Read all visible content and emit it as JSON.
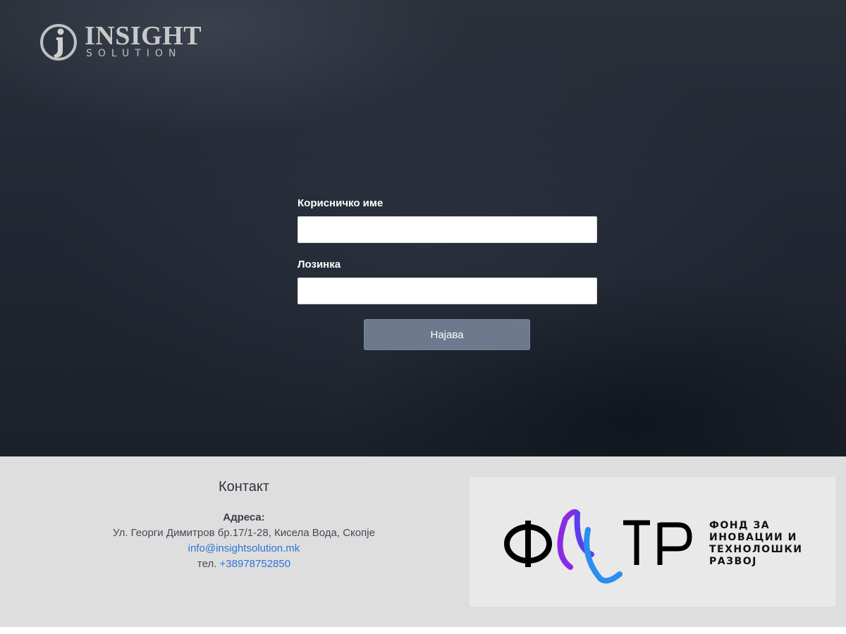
{
  "brand": {
    "name": "INSIGHT",
    "subtitle": "SOLUTION"
  },
  "login": {
    "username_label": "Корисничко име",
    "username_value": "",
    "password_label": "Лозинка",
    "password_value": "",
    "submit_label": "Најава"
  },
  "contact": {
    "title": "Контакт",
    "address_label": "Адреса:",
    "address": "Ул. Георги Димитров бр.17/1-28, Кисела Вода, Скопје",
    "email": "info@insightsolution.mk",
    "phone_prefix": "тел.",
    "phone": "+38978752850"
  },
  "partner": {
    "wordmark": "ФИТР",
    "lines": [
      "ФОНД ЗА",
      "ИНОВАЦИИ И",
      "ТЕХНОЛОШКИ",
      "РАЗВОЈ"
    ]
  },
  "colors": {
    "button": "#6d7a8e",
    "link": "#2f72d6",
    "footer_bg": "#dedede"
  }
}
